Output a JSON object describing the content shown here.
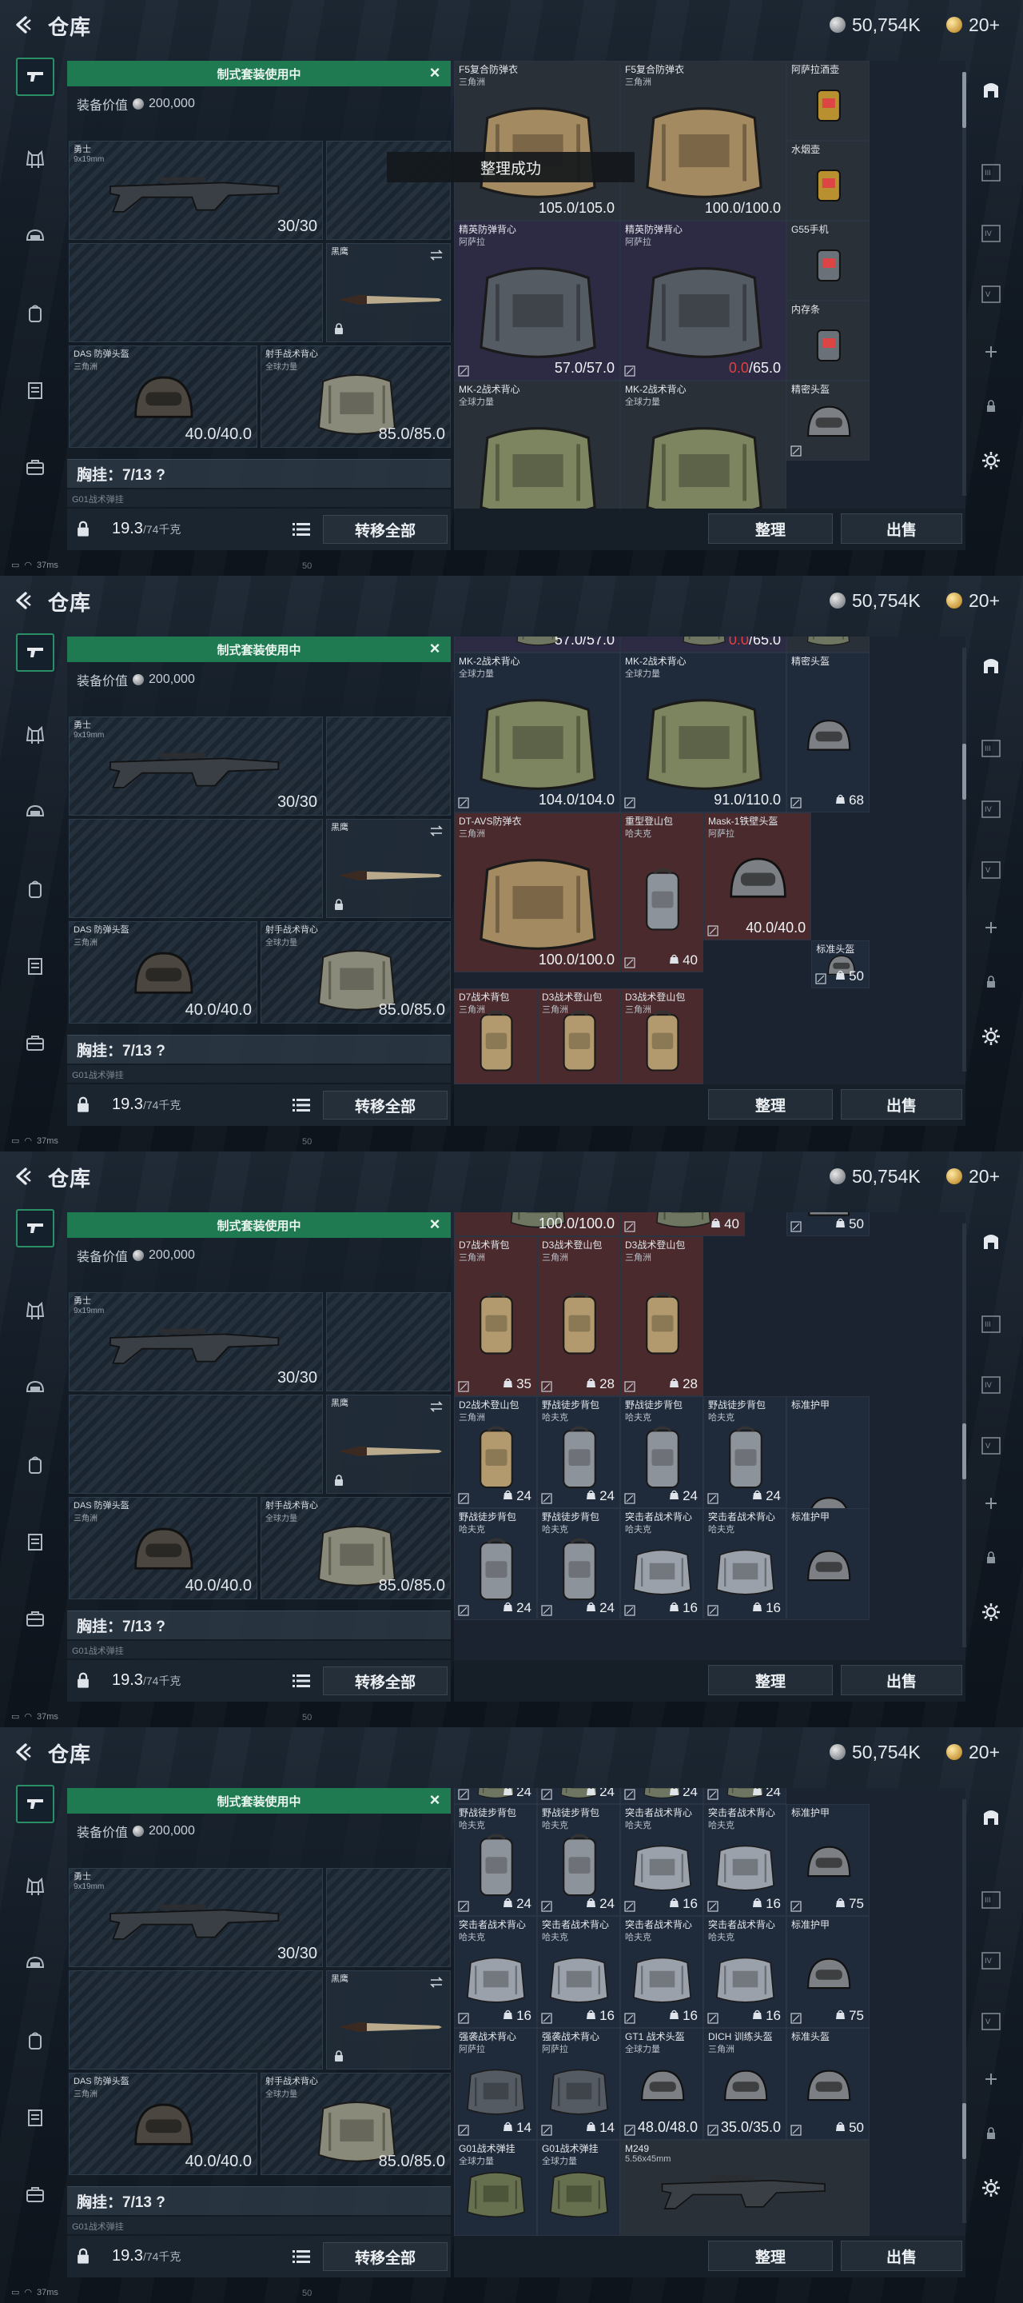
{
  "topbar": {
    "title": "仓库",
    "silver": "50,754K",
    "gold": "20+"
  },
  "loadout": {
    "banner": "制式套装使用中",
    "equip_value_label": "装备价值",
    "equip_value": "200,000",
    "primary": {
      "name": "勇士",
      "sub": "9x19mm",
      "dur": "30/30"
    },
    "knife": {
      "name": "黑鹰"
    },
    "helmet": {
      "name": "DAS 防弹头盔",
      "sub": "三角洲",
      "dur": "40.0/40.0"
    },
    "rig": {
      "name": "射手战术背心",
      "sub": "全球力量",
      "dur": "85.0/85.0"
    },
    "chest": "胸挂：7/13 ?",
    "g01": "G01战术弹挂",
    "weight": "19.3",
    "weight_cap": "/74千克",
    "transfer": "转移全部"
  },
  "footer": {
    "sort": "整理",
    "sell": "出售"
  },
  "status": {
    "ping": "37ms",
    "fps": "50"
  },
  "toast": "整理成功",
  "frames": [
    [
      {
        "name": "F5复合防弹衣",
        "sub": "三角洲",
        "dur": "105.0/105.0",
        "color": "gray"
      },
      {
        "name": "F5复合防弹衣",
        "sub": "三角洲",
        "dur": "100.0/100.0",
        "color": "gray"
      },
      {
        "name": "阿萨拉酒壶",
        "sub": "",
        "dur": "",
        "color": "gray"
      },
      {
        "name": "水烟壶",
        "sub": "",
        "dur": "",
        "color": "gray"
      },
      {
        "name": "精英防弹背心",
        "sub": "阿萨拉",
        "dur": "57.0/57.0",
        "color": "purple"
      },
      {
        "name": "精英防弹背心",
        "sub": "阿萨拉",
        "dur_ok": "/65.0",
        "dur_bad": "0.0",
        "color": "purple"
      },
      {
        "name": "G55手机",
        "sub": "",
        "dur": "",
        "color": "gray"
      },
      {
        "name": "内存条",
        "sub": "",
        "dur": "",
        "color": "gray"
      },
      {
        "name": "MK-2战术背心",
        "sub": "全球力量",
        "dur": "",
        "color": "gray"
      },
      {
        "name": "MK-2战术背心",
        "sub": "全球力量",
        "dur": "",
        "color": "gray"
      },
      {
        "name": "精密头盔",
        "sub": "",
        "dur": "",
        "color": "gray"
      }
    ],
    [
      {
        "name": "",
        "sub": "",
        "dur": "57.0/57.0",
        "color": "purple"
      },
      {
        "name": "",
        "sub": "",
        "dur_ok": "/65.0",
        "dur_bad": "0.0",
        "color": "purple"
      },
      {
        "name": "",
        "sub": "",
        "dur": "",
        "color": "gray"
      },
      {
        "name": "MK-2战术背心",
        "sub": "全球力量",
        "dur": "104.0/104.0",
        "color": "blue"
      },
      {
        "name": "MK-2战术背心",
        "sub": "全球力量",
        "dur": "91.0/110.0",
        "color": "blue"
      },
      {
        "name": "精密头盔",
        "sub": "",
        "cap": "68",
        "color": "blue"
      },
      {
        "name": "DT-AVS防弹衣",
        "sub": "三角洲",
        "dur": "100.0/100.0",
        "color": "red"
      },
      {
        "name": "重型登山包",
        "sub": "哈夫克",
        "cap": "40",
        "color": "red"
      },
      {
        "name": "Mask-1铁壁头盔",
        "sub": "阿萨拉",
        "dur": "40.0/40.0",
        "color": "red"
      },
      {
        "name": "标准头盔",
        "sub": "",
        "cap": "50",
        "color": "blue"
      },
      {
        "name": "D7战术背包",
        "sub": "三角洲",
        "dur": "",
        "color": "red"
      },
      {
        "name": "D3战术登山包",
        "sub": "三角洲",
        "dur": "",
        "color": "red"
      },
      {
        "name": "D3战术登山包",
        "sub": "三角洲",
        "dur": "",
        "color": "red"
      }
    ],
    [
      {
        "name": "",
        "sub": "",
        "dur": "100.0/100.0",
        "color": "red"
      },
      {
        "name": "",
        "sub": "",
        "cap": "40",
        "color": "red"
      },
      {
        "name": "标准头盔",
        "sub": "",
        "cap": "50",
        "color": "blue"
      },
      {
        "name": "D7战术背包",
        "sub": "三角洲",
        "cap": "35",
        "color": "red"
      },
      {
        "name": "D3战术登山包",
        "sub": "三角洲",
        "cap": "28",
        "color": "red"
      },
      {
        "name": "D3战术登山包",
        "sub": "三角洲",
        "cap": "28",
        "color": "red"
      },
      {
        "name": "D2战术登山包",
        "sub": "三角洲",
        "cap": "24",
        "color": "blue"
      },
      {
        "name": "野战徒步背包",
        "sub": "哈夫克",
        "cap": "24",
        "color": "blue"
      },
      {
        "name": "野战徒步背包",
        "sub": "哈夫克",
        "cap": "24",
        "color": "blue"
      },
      {
        "name": "野战徒步背包",
        "sub": "哈夫克",
        "cap": "24",
        "color": "blue"
      },
      {
        "name": "标准护甲",
        "sub": "",
        "cap": "75",
        "color": "blue"
      },
      {
        "name": "野战徒步背包",
        "sub": "哈夫克",
        "cap": "24",
        "color": "blue"
      },
      {
        "name": "野战徒步背包",
        "sub": "哈夫克",
        "cap": "24",
        "color": "blue"
      },
      {
        "name": "突击者战术背心",
        "sub": "哈夫克",
        "cap": "16",
        "color": "blue"
      },
      {
        "name": "突击者战术背心",
        "sub": "哈夫克",
        "cap": "16",
        "color": "blue"
      },
      {
        "name": "标准护甲",
        "sub": "",
        "cap": "",
        "color": "blue"
      }
    ],
    [
      {
        "name": "",
        "sub": "",
        "cap": "24",
        "color": "blue"
      },
      {
        "name": "",
        "sub": "",
        "cap": "24",
        "color": "blue"
      },
      {
        "name": "",
        "sub": "",
        "cap": "24",
        "color": "blue"
      },
      {
        "name": "",
        "sub": "",
        "cap": "24",
        "color": "blue"
      },
      {
        "name": "野战徒步背包",
        "sub": "哈夫克",
        "cap": "24",
        "color": "blue"
      },
      {
        "name": "野战徒步背包",
        "sub": "哈夫克",
        "cap": "24",
        "color": "blue"
      },
      {
        "name": "突击者战术背心",
        "sub": "哈夫克",
        "cap": "16",
        "color": "blue"
      },
      {
        "name": "突击者战术背心",
        "sub": "哈夫克",
        "cap": "16",
        "color": "blue"
      },
      {
        "name": "标准护甲",
        "sub": "",
        "cap": "75",
        "color": "blue"
      },
      {
        "name": "突击者战术背心",
        "sub": "哈夫克",
        "cap": "16",
        "color": "blue"
      },
      {
        "name": "突击者战术背心",
        "sub": "哈夫克",
        "cap": "16",
        "color": "blue"
      },
      {
        "name": "突击者战术背心",
        "sub": "哈夫克",
        "cap": "16",
        "color": "blue"
      },
      {
        "name": "突击者战术背心",
        "sub": "哈夫克",
        "cap": "16",
        "color": "blue"
      },
      {
        "name": "标准护甲",
        "sub": "",
        "cap": "75",
        "color": "blue"
      },
      {
        "name": "强袭战术背心",
        "sub": "阿萨拉",
        "cap": "14",
        "color": "blue"
      },
      {
        "name": "强袭战术背心",
        "sub": "阿萨拉",
        "cap": "14",
        "color": "blue"
      },
      {
        "name": "GT1 战术头盔",
        "sub": "全球力量",
        "dur": "48.0/48.0",
        "color": "blue"
      },
      {
        "name": "DICH 训练头盔",
        "sub": "三角洲",
        "dur": "35.0/35.0",
        "color": "blue"
      },
      {
        "name": "标准头盔",
        "sub": "",
        "cap": "50",
        "color": "blue"
      },
      {
        "name": "G01战术弹挂",
        "sub": "全球力量",
        "dur": "",
        "color": "blue"
      },
      {
        "name": "G01战术弹挂",
        "sub": "全球力量",
        "dur": "",
        "color": "blue"
      },
      {
        "name": "M249",
        "sub": "5.56x45mm",
        "dur": "",
        "color": "gray"
      }
    ]
  ]
}
